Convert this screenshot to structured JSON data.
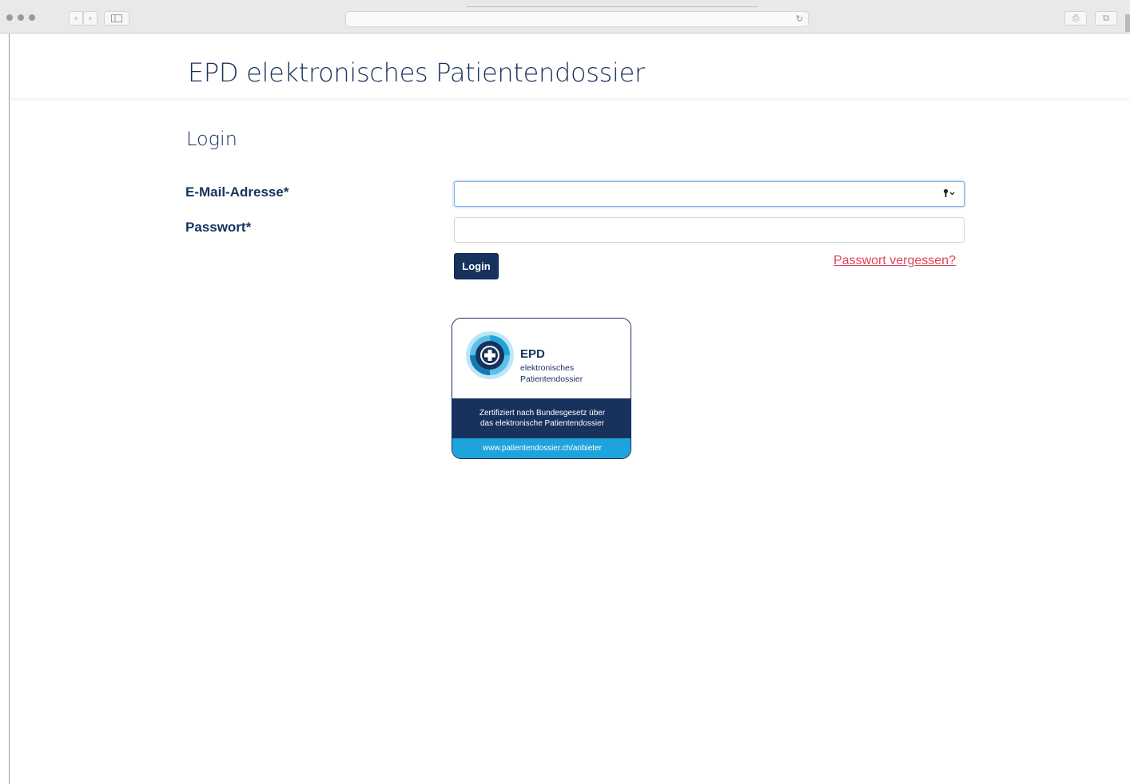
{
  "browser": {
    "back_icon": "‹",
    "forward_icon": "›",
    "reload_icon": "↻",
    "share_icon": "⎙",
    "tabs_icon": "⧉"
  },
  "header": {
    "title": "EPD elektronisches Patientendossier"
  },
  "login": {
    "section_title": "Login",
    "email_label": "E-Mail-Adresse*",
    "email_value": "",
    "password_label": "Passwort*",
    "password_value": "",
    "login_button": "Login",
    "forgot_link": "Passwort vergessen?"
  },
  "badge": {
    "name": "EPD",
    "sub_line1": "elektronisches",
    "sub_line2": "Patientendossier",
    "cert_line1": "Zertifiziert nach Bundesgesetz über",
    "cert_line2": "das elektronische Patientendossier",
    "url": "www.patientendossier.ch/anbieter"
  },
  "colors": {
    "primary": "#17325c",
    "link": "#e0435b",
    "badge_accent": "#1ea3dc"
  }
}
